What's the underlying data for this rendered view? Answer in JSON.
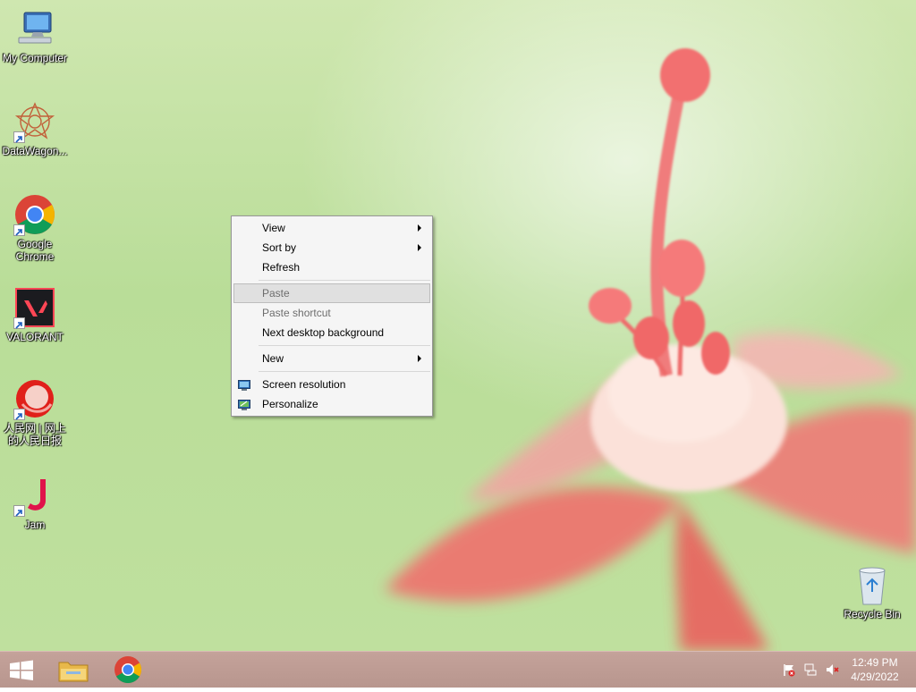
{
  "desktop_icons": [
    {
      "id": "my-computer",
      "label": "My Computer"
    },
    {
      "id": "datawagon",
      "label": "DataWagon..."
    },
    {
      "id": "google-chrome",
      "label": "Google Chrome"
    },
    {
      "id": "valorant",
      "label": "VALORANT"
    },
    {
      "id": "people-daily",
      "label": "人民网 | 网上的人民日报"
    },
    {
      "id": "jam",
      "label": "Jam"
    },
    {
      "id": "recycle-bin",
      "label": "Recycle Bin"
    }
  ],
  "context_menu": {
    "view": "View",
    "sort_by": "Sort by",
    "refresh": "Refresh",
    "paste": "Paste",
    "paste_shortcut": "Paste shortcut",
    "next_background": "Next desktop background",
    "new": "New",
    "screen_resolution": "Screen resolution",
    "personalize": "Personalize"
  },
  "taskbar": {
    "time": "12:49 PM",
    "date": "4/29/2022",
    "pinned": [
      "start-button",
      "file-explorer",
      "chrome"
    ]
  },
  "colors": {
    "taskbar": "#b8968e",
    "menu_bg": "#f5f5f5",
    "chrome_red": "#db4437",
    "chrome_yellow": "#f4b400",
    "chrome_green": "#0f9d58",
    "chrome_blue": "#4285f4"
  }
}
